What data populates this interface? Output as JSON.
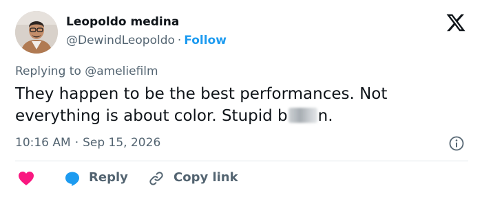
{
  "author": {
    "name": "Leopoldo medina",
    "handle": "@DewindLeopoldo",
    "separator": "·",
    "follow_label": "Follow"
  },
  "reply": {
    "prefix": "Replying to",
    "mention": "@ameliefilm"
  },
  "tweet": {
    "text_before": "They happen to be the best performances. Not everything is about color. Stupid b",
    "text_after": "n."
  },
  "meta": {
    "time": "10:16 AM",
    "separator": "·",
    "date": "Sep 15, 2026"
  },
  "actions": {
    "reply_label": "Reply",
    "copy_link_label": "Copy link"
  },
  "icons": {
    "logo": "x-logo-icon",
    "info": "info-icon",
    "like": "heart-icon",
    "reply": "reply-bubble-icon",
    "link": "link-icon"
  },
  "colors": {
    "accent": "#1d9bf0",
    "like": "#f91880",
    "muted": "#536471",
    "text": "#0f1419"
  }
}
